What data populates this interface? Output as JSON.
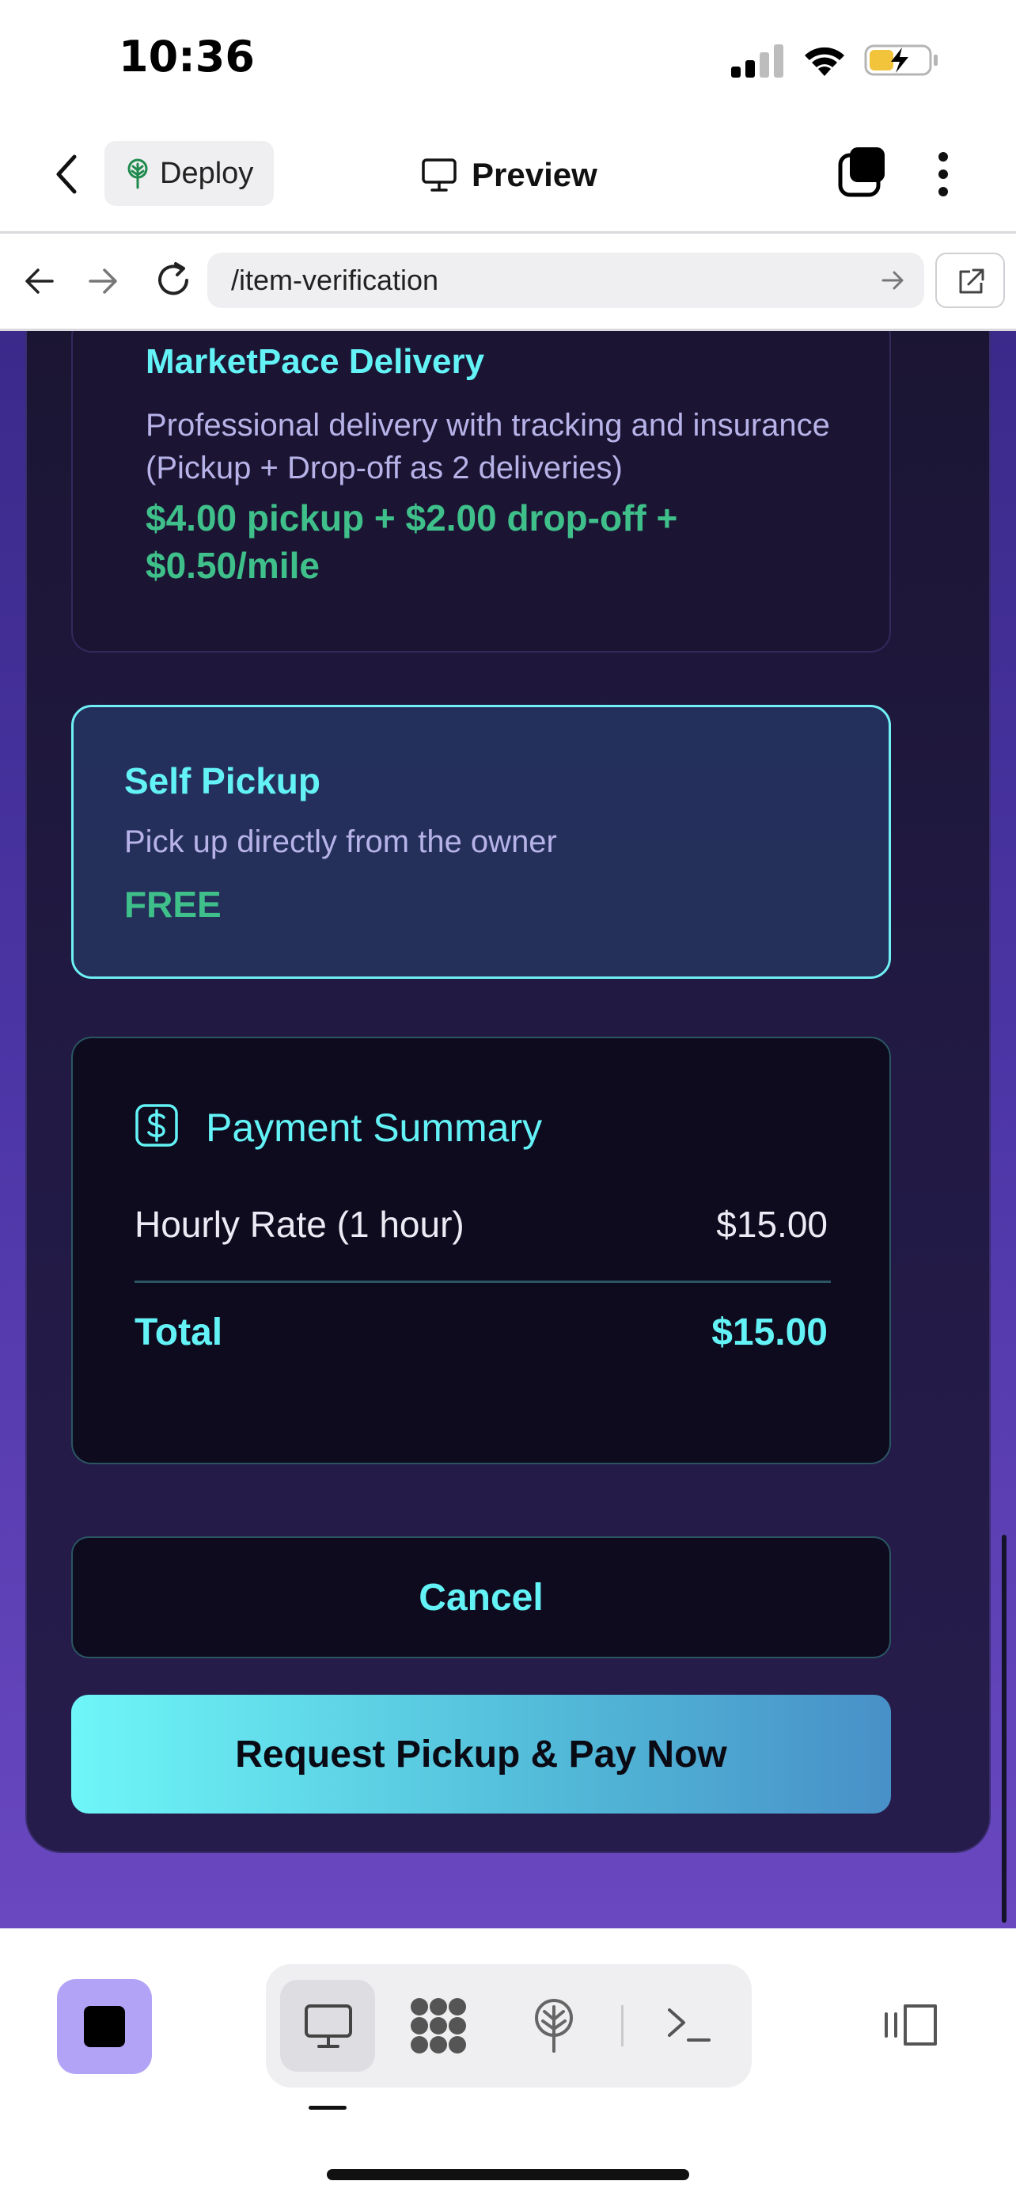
{
  "status": {
    "time": "10:36"
  },
  "toolbar": {
    "deploy_label": "Deploy",
    "preview_label": "Preview"
  },
  "browser": {
    "url": "/item-verification"
  },
  "delivery_options": [
    {
      "title": "MarketPace Delivery",
      "description": "Professional delivery with tracking and insurance (Pickup + Drop-off as 2 deliveries)",
      "price": "$4.00 pickup + $2.00 drop-off + $0.50/mile"
    },
    {
      "title": "Self Pickup",
      "description": "Pick up directly from the owner",
      "price": "FREE",
      "selected": true
    }
  ],
  "payment_summary": {
    "title": "Payment Summary",
    "line_items": [
      {
        "label": "Hourly Rate (1 hour)",
        "amount": "$15.00"
      }
    ],
    "total_label": "Total",
    "total_amount": "$15.00"
  },
  "actions": {
    "cancel_label": "Cancel",
    "submit_label": "Request Pickup & Pay Now"
  },
  "colors": {
    "accent_cyan": "#63f2f6",
    "price_green": "#3fc08b",
    "panel_bg": "#1b1533",
    "page_purple": "#4b35a5"
  }
}
